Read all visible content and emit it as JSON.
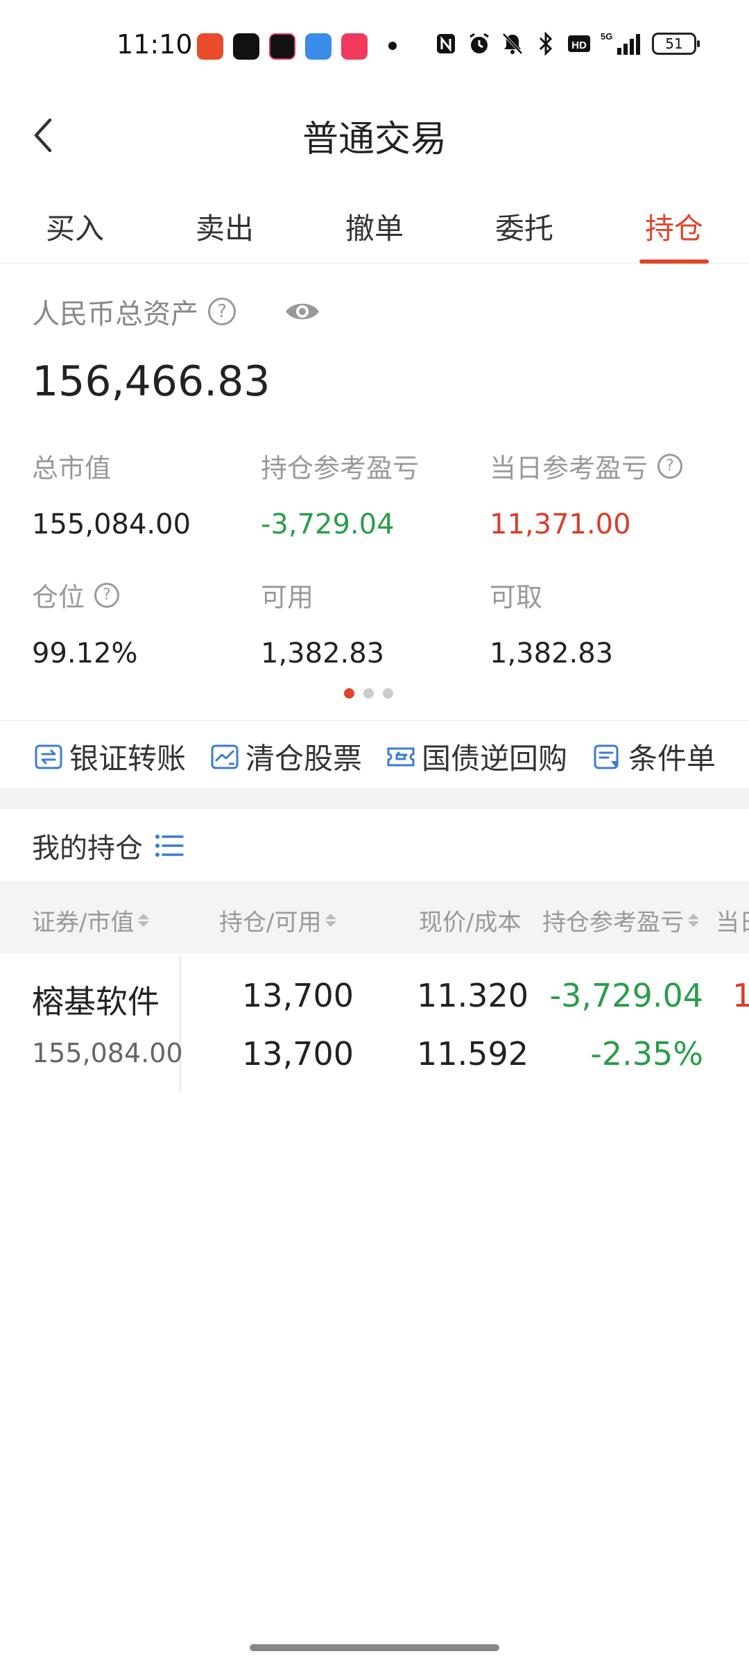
{
  "status_bar": {
    "time": "11:10",
    "network": "5G",
    "battery": "51"
  },
  "header": {
    "title": "普通交易"
  },
  "tabs": [
    {
      "label": "买入"
    },
    {
      "label": "卖出"
    },
    {
      "label": "撤单"
    },
    {
      "label": "委托"
    },
    {
      "label": "持仓"
    }
  ],
  "active_tab": "持仓",
  "assets": {
    "label": "人民币总资产",
    "total": "156,466.83",
    "metrics": {
      "market_value": {
        "label": "总市值",
        "value": "155,084.00"
      },
      "position_pnl": {
        "label": "持仓参考盈亏",
        "value": "-3,729.04"
      },
      "daily_pnl": {
        "label": "当日参考盈亏",
        "value": "11,371.00"
      },
      "position_ratio": {
        "label": "仓位",
        "value": "99.12%"
      },
      "available": {
        "label": "可用",
        "value": "1,382.83"
      },
      "withdrawable": {
        "label": "可取",
        "value": "1,382.83"
      }
    }
  },
  "quick_actions": [
    {
      "label": "银证转账"
    },
    {
      "label": "清仓股票"
    },
    {
      "label": "国债逆回购"
    },
    {
      "label": "条件单"
    }
  ],
  "positions": {
    "title": "我的持仓",
    "columns": [
      "证券/市值",
      "持仓/可用",
      "现价/成本",
      "持仓参考盈亏",
      "当日"
    ],
    "rows": [
      {
        "name": "榕基软件",
        "market_value": "155,084.00",
        "holding": "13,700",
        "available": "13,700",
        "price": "11.320",
        "cost": "11.592",
        "pnl": "-3,729.04",
        "pnl_pct": "-2.35%",
        "daily_partial": "1"
      }
    ]
  },
  "colors": {
    "accent": "#e0452c",
    "loss": "#2a9d4a",
    "gain": "#dd3b26",
    "icon_blue": "#3a7bd5"
  }
}
